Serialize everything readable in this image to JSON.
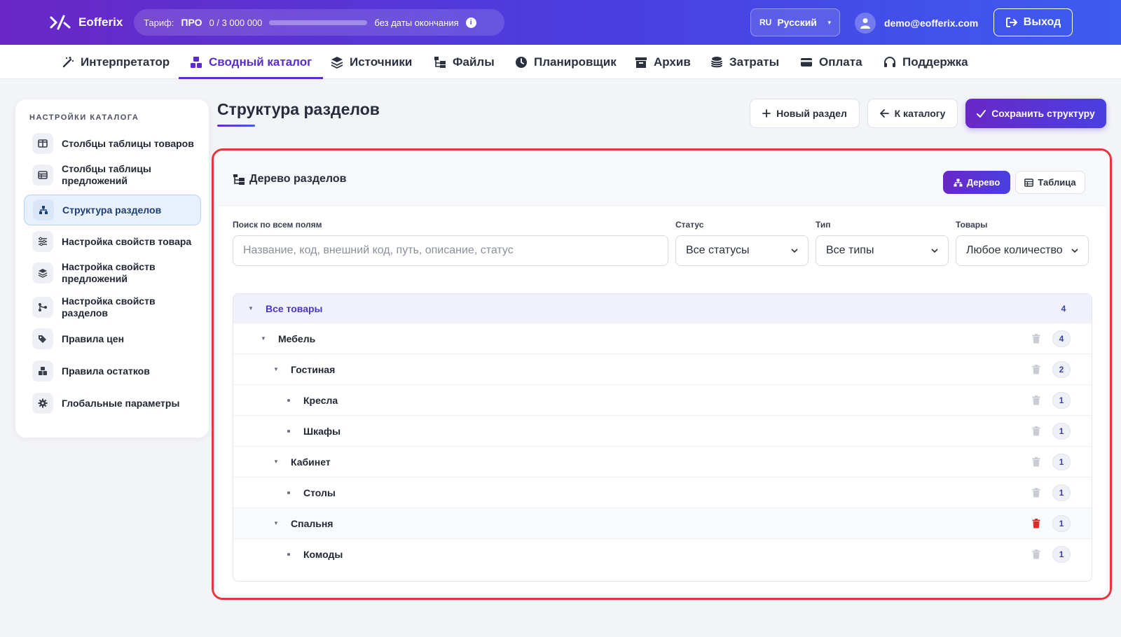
{
  "header": {
    "brand": "Eofferix",
    "tariff": {
      "label": "Тариф:",
      "plan": "ПРО",
      "used": "0 / 3 000 000",
      "usage_fraction": 0.0,
      "expiry": "без даты окончания"
    },
    "language": {
      "code": "RU",
      "name": "Русский"
    },
    "user_email": "demo@eofferix.com",
    "logout_label": "Выход"
  },
  "nav": {
    "items": [
      {
        "label": "Интерпретатор",
        "icon": "magic-wand-icon"
      },
      {
        "label": "Сводный каталог",
        "icon": "boxes-icon",
        "active": true
      },
      {
        "label": "Источники",
        "icon": "layers-icon"
      },
      {
        "label": "Файлы",
        "icon": "folder-tree-icon"
      },
      {
        "label": "Планировщик",
        "icon": "clock-icon"
      },
      {
        "label": "Архив",
        "icon": "archive-icon"
      },
      {
        "label": "Затраты",
        "icon": "coins-icon"
      },
      {
        "label": "Оплата",
        "icon": "credit-card-icon"
      },
      {
        "label": "Поддержка",
        "icon": "headset-icon"
      }
    ]
  },
  "sidebar": {
    "title": "НАСТРОЙКИ КАТАЛОГА",
    "items": [
      {
        "label": "Столбцы таблицы товаров",
        "icon": "columns-icon"
      },
      {
        "label": "Столбцы таблицы предложений",
        "icon": "table-icon"
      },
      {
        "label": "Структура разделов",
        "icon": "sitemap-icon",
        "active": true
      },
      {
        "label": "Настройка свойств товара",
        "icon": "sliders-icon"
      },
      {
        "label": "Настройка свойств предложений",
        "icon": "layers-icon"
      },
      {
        "label": "Настройка свойств разделов",
        "icon": "branch-icon"
      },
      {
        "label": "Правила цен",
        "icon": "tags-icon"
      },
      {
        "label": "Правила остатков",
        "icon": "boxes-icon"
      },
      {
        "label": "Глобальные параметры",
        "icon": "gear-icon"
      }
    ]
  },
  "main": {
    "title": "Структура разделов",
    "buttons": {
      "new_section": "Новый раздел",
      "to_catalog": "К каталогу",
      "save": "Сохранить структуру"
    },
    "panel": {
      "title": "Дерево разделов",
      "view_tree": "Дерево",
      "view_table": "Таблица",
      "filters": {
        "search_label": "Поиск по всем полям",
        "search_placeholder": "Название, код, внешний код, путь, описание, статус",
        "status_label": "Статус",
        "status_value": "Все статусы",
        "type_label": "Тип",
        "type_value": "Все типы",
        "goods_label": "Товары",
        "goods_value": "Любое количество"
      },
      "tree": [
        {
          "name": "Все товары",
          "count": "4",
          "level": 0,
          "expandable": true
        },
        {
          "name": "Мебель",
          "count": "4",
          "level": 1,
          "expandable": true
        },
        {
          "name": "Гостиная",
          "count": "2",
          "level": 2,
          "expandable": true
        },
        {
          "name": "Кресла",
          "count": "1",
          "level": 3,
          "expandable": false
        },
        {
          "name": "Шкафы",
          "count": "1",
          "level": 3,
          "expandable": false
        },
        {
          "name": "Кабинет",
          "count": "1",
          "level": 2,
          "expandable": true
        },
        {
          "name": "Столы",
          "count": "1",
          "level": 3,
          "expandable": false
        },
        {
          "name": "Спальня",
          "count": "1",
          "level": 2,
          "expandable": true,
          "trash_color": "#e02a2a"
        },
        {
          "name": "Комоды",
          "count": "1",
          "level": 3,
          "expandable": false
        }
      ]
    }
  },
  "colors": {
    "accent": "#5b2bd0",
    "highlight_border": "#e2383d",
    "trash_default": "#c9ccd4",
    "trash_hover": "#e02a2a"
  }
}
